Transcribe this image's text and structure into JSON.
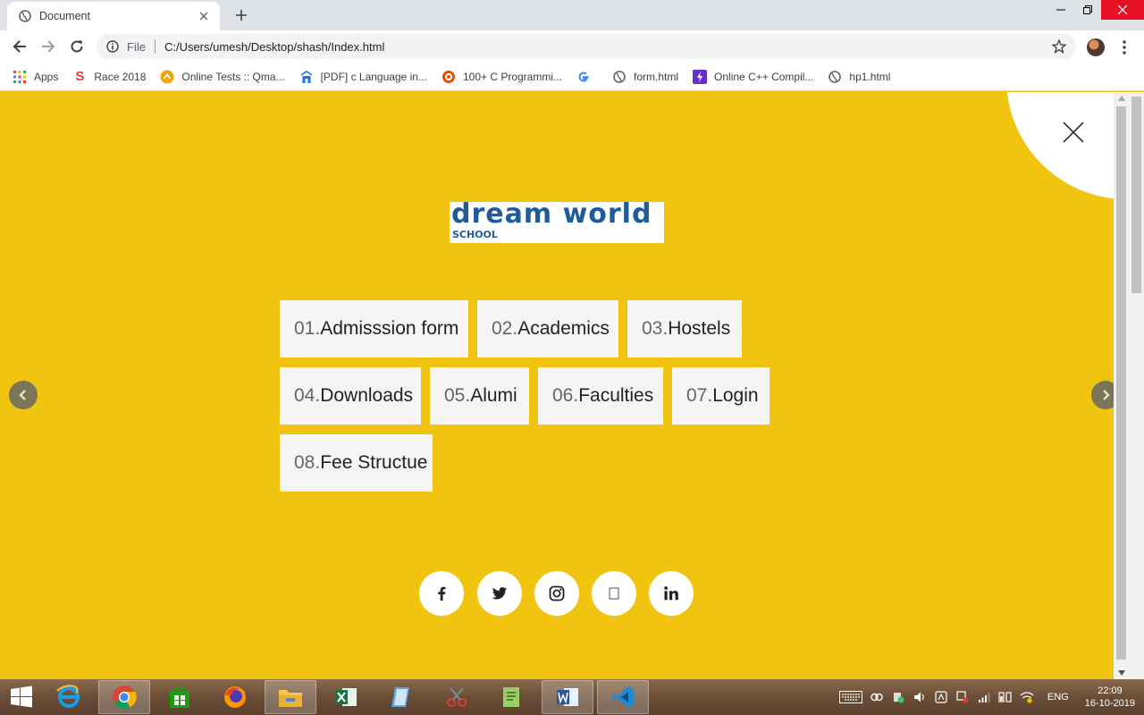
{
  "browser": {
    "tab_title": "Document",
    "address_scheme": "File",
    "address_url": "C:/Users/umesh/Desktop/shash/Index.html"
  },
  "bookmarks": [
    {
      "label": "Apps",
      "icon": "apps-grid-icon"
    },
    {
      "label": "Race 2018",
      "icon": "race-s-icon"
    },
    {
      "label": "Online Tests :: Qma...",
      "icon": "qma-icon"
    },
    {
      "label": "[PDF] c Language in...",
      "icon": "pdf-icon"
    },
    {
      "label": "100+ C Programmi...",
      "icon": "programming-icon"
    },
    {
      "label": "",
      "icon": "google-icon"
    },
    {
      "label": "form.html",
      "icon": "globe-icon"
    },
    {
      "label": "Online C++ Compil...",
      "icon": "compiler-icon"
    },
    {
      "label": "hp1.html",
      "icon": "globe-icon"
    }
  ],
  "logo": {
    "title": "dream world",
    "subtitle": "SCHOOL"
  },
  "menu": [
    {
      "num": "01.",
      "label": "Admisssion form"
    },
    {
      "num": "02.",
      "label": "Academics"
    },
    {
      "num": "03.",
      "label": "Hostels"
    },
    {
      "num": "04.",
      "label": "Downloads"
    },
    {
      "num": "05.",
      "label": "Alumi"
    },
    {
      "num": "06.",
      "label": "Faculties"
    },
    {
      "num": "07.",
      "label": "Login"
    },
    {
      "num": "08.",
      "label": "Fee Structue"
    }
  ],
  "social": [
    {
      "name": "facebook",
      "glyph": "f"
    },
    {
      "name": "twitter",
      "glyph": ""
    },
    {
      "name": "instagram",
      "glyph": ""
    },
    {
      "name": "blank",
      "glyph": "□"
    },
    {
      "name": "linkedin",
      "glyph": "in"
    }
  ],
  "colors": {
    "page_background": "#f1c40f",
    "menu_item_background": "#f5f5f5",
    "logo_blue": "#1e5b9c"
  },
  "taskbar": {
    "language": "ENG",
    "time": "22:09",
    "date": "16-10-2019"
  }
}
